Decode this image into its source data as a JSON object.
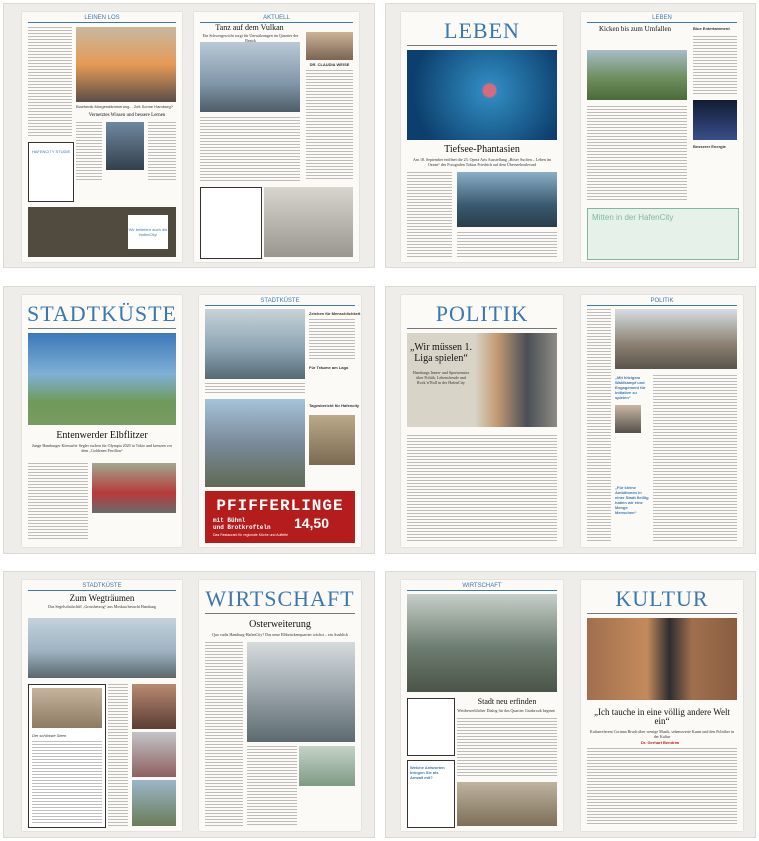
{
  "spreads": [
    {
      "left_section": "LEINEN LOS",
      "right_section": "AKTUELL",
      "left_caption": "Bowhenik Morgendämmerung... Zeit Sonne Hamburg?",
      "left_headline": "Vernetztes Wissen und bessere Lernen",
      "right_headline": "Tanz auf dem Vulkan",
      "right_subline": "Ein Schwergewicht sorgt für Umwälzungen im Quartier der Bezirk",
      "right_author": "DR. CLAUDIA WEISE",
      "hafencity_box": "HAFENCITY STUDIE",
      "ad_text": "Wir beliefern auch die HafenCity!"
    },
    {
      "left_section": "LEBEN",
      "right_section": "LEBEN",
      "left_headline": "Tiefsee-Phantasien",
      "left_subline": "Am 18. September eröffnet die 23. Opera Arts Ausstellung „Böser Suchen – Leben im Ozean“ des Fotografen Tobias Friedrich auf dem Überseeboulevard",
      "right_headline": "Kicken bis zum Umfallen",
      "right_side_head": "Blue Entertainment",
      "right_side_head2": "Besserer Energie",
      "ad_text": "Mitten in der HafenCity"
    },
    {
      "left_section": "STADTKÜSTE",
      "right_section": "STADTKÜSTE",
      "left_headline": "Entenwerder Elbflitzer",
      "left_subline": "Junge Hamburger Kitesurfer Segler suchen für Olympia 2020 in Tokio und kreuzen vor dem „Goldenen Pavillon“",
      "right_side_head": "Zeichen für Menschlichkeit",
      "right_side_head2": "Für Träume am Lago",
      "right_side_head3": "Tagesbericht für Hafencity",
      "ad_headline": "PFIFFERLINGE",
      "ad_line1": "mit Bühnl",
      "ad_line2": "und Brotkrofteln",
      "ad_price": "14,50",
      "ad_line3": "Das Restaurant für regionale Küche und Aufteile"
    },
    {
      "left_section": "POLITIK",
      "right_section": "POLITIK",
      "left_headline": "„Wir müssen 1. Liga spielen“",
      "left_subline": "Hamburgs Innen- und Sportsenator über Politik, Lebensfreude und Rock’n’Roll in der HafenCity",
      "quote1": "„Mit hitzigem Wahlkampf und Engagement für Initiative zu spielen“",
      "quote2": "„Für kleine Ambitionen in einer Stadt fleißig haben wir eine Menge Menschen“"
    },
    {
      "left_section": "STADTKÜSTE",
      "right_section": "WIRTSCHAFT",
      "left_headline": "Zum Wegträumen",
      "left_subline": "Das Segelschulschiff „Grossherzog“ aus Moskau besucht Hamburg",
      "left_box_head": "Der schönste Stern",
      "right_headline": "Osterweiterung",
      "right_subline": "Quo vadis Hamburg-HafenCity? Das neue Elbbrückenquartier wächst – ein Ausblick"
    },
    {
      "left_section": "WIRTSCHAFT",
      "right_section": "KULTUR",
      "left_headline": "Stadt neu erfinden",
      "left_subline": "Wettbewerblicher Dialog für das Quartier Grasbrook beginnt",
      "left_box_head": "Welche Antworten bringen Sie als Anwalt mit?",
      "right_headline": "„Ich tauche in eine völlig andere Welt ein“",
      "right_subline": "Kulturreferent Corinna Bruch über wenige Musik, sehenswerte Kunst und den Politiker in der Kultur",
      "right_author": "Dr. Gerhart Bendrim"
    }
  ],
  "colors": {
    "section_blue": "#3b78b0",
    "ad_red": "#b51c1c",
    "ad_green": "#7fb8a0"
  }
}
